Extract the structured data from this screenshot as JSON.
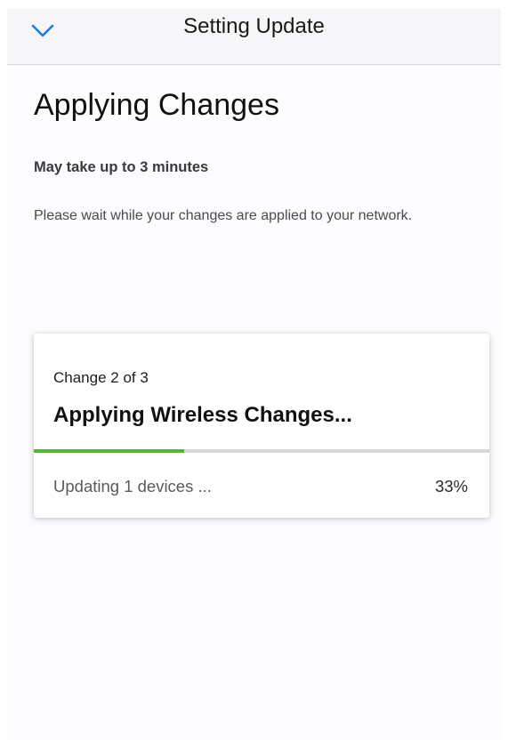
{
  "nav": {
    "title": "Setting Update",
    "back_icon": "chevron-down-icon"
  },
  "page": {
    "title": "Applying Changes",
    "subtitle": "May take up to 3 minutes",
    "description": "Please wait while your changes are applied to your network."
  },
  "progress_card": {
    "step_label": "Change 2 of 3",
    "heading": "Applying Wireless Changes...",
    "status_text": "Updating 1 devices ...",
    "percent_label": "33%",
    "progress_fraction": 0.33
  },
  "colors": {
    "accent_blue": "#1a7ee0",
    "progress_green": "#57b33e",
    "progress_track": "#d6d6d8"
  }
}
